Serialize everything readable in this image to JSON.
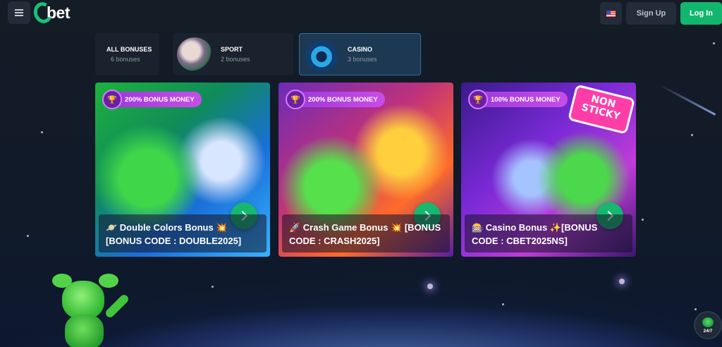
{
  "header": {
    "logo_text": "bet",
    "language": "US",
    "signup_label": "Sign Up",
    "login_label": "Log In"
  },
  "categories": [
    {
      "title": "ALL BONUSES",
      "count": "6 bonuses",
      "active": false
    },
    {
      "title": "SPORT",
      "count": "2 bonuses",
      "active": false
    },
    {
      "title": "CASINO",
      "count": "3 bonuses",
      "active": true
    }
  ],
  "promos": [
    {
      "badge": "200% BONUS MONEY",
      "title": "🪐 Double Colors Bonus 💥 [BONUS CODE : DOUBLE2025]"
    },
    {
      "badge": "200% BONUS MONEY",
      "title": "🚀 Crash Game Bonus 💥 [BONUS CODE : CRASH2025]"
    },
    {
      "badge": "100% BONUS MONEY",
      "title": "🎰 Casino Bonus ✨[BONUS CODE : CBET2025NS]",
      "sticker": "NON STICKY"
    }
  ],
  "support": {
    "label": "24/7"
  },
  "colors": {
    "accent": "#13b66e",
    "background": "#141c26",
    "active_tab": "#1c3852"
  }
}
